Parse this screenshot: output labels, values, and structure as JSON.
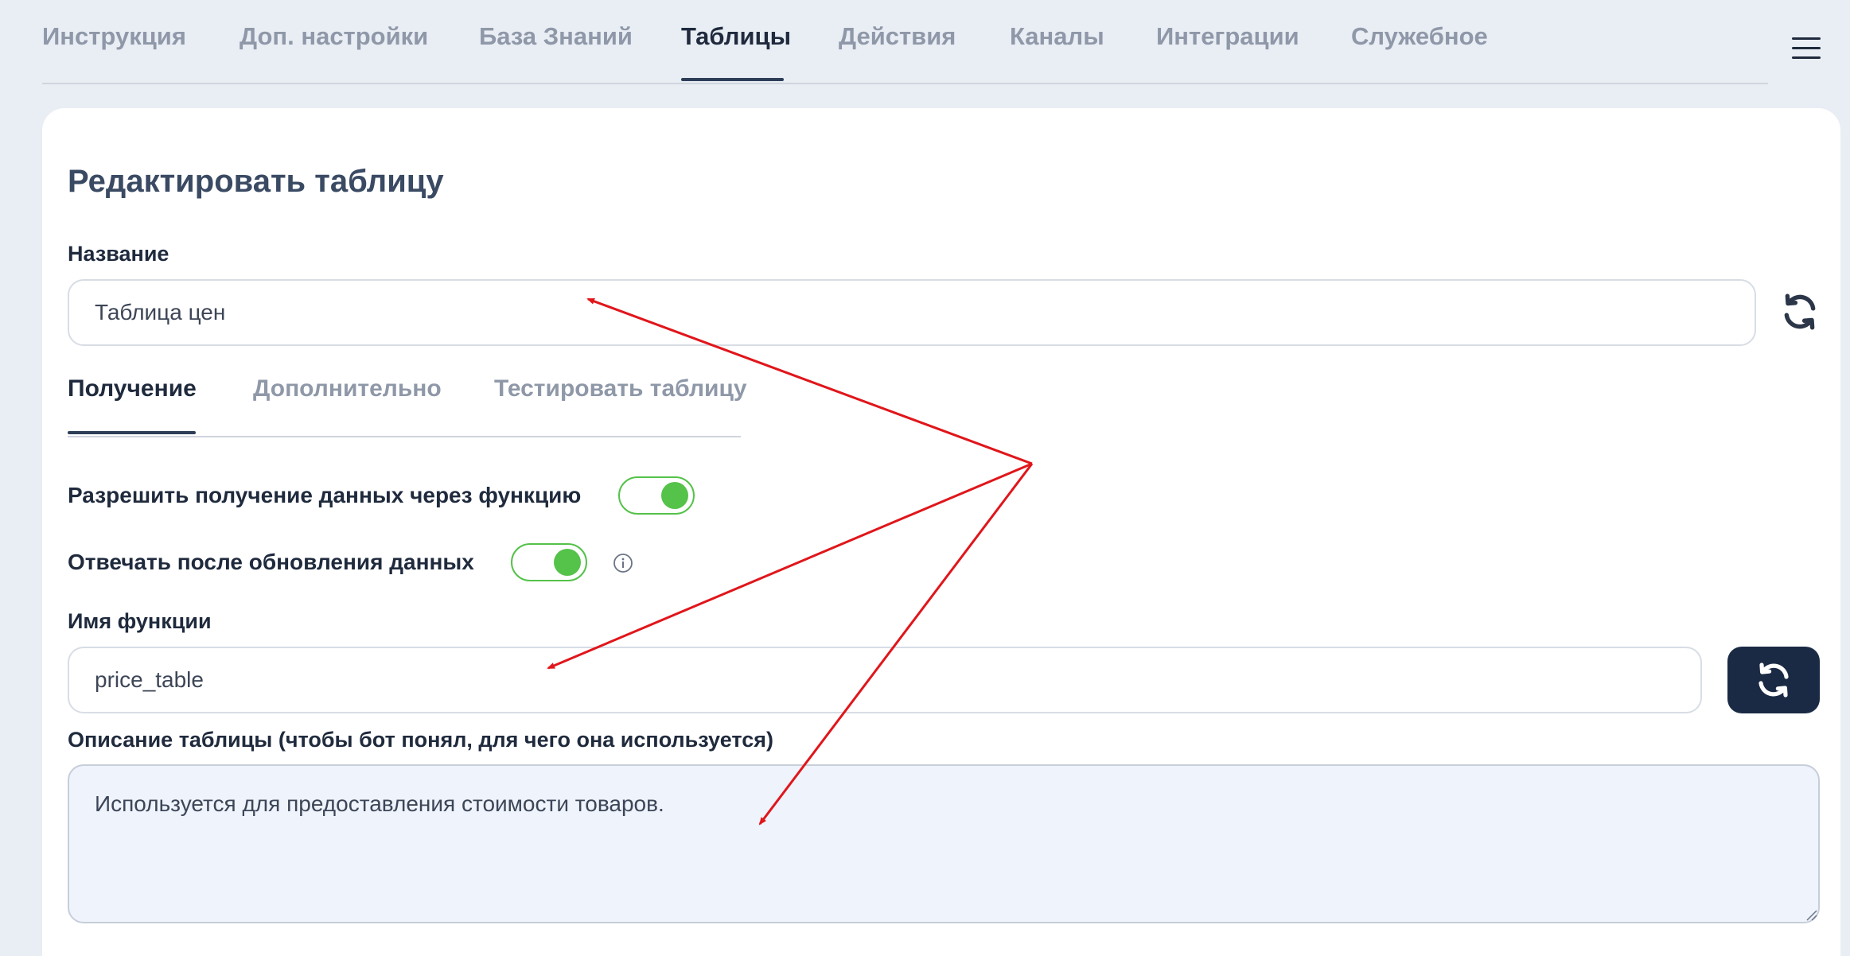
{
  "top_nav": {
    "tabs": [
      {
        "label": "Инструкция",
        "active": false
      },
      {
        "label": "Доп. настройки",
        "active": false
      },
      {
        "label": "База Знаний",
        "active": false
      },
      {
        "label": "Таблицы",
        "active": true
      },
      {
        "label": "Действия",
        "active": false
      },
      {
        "label": "Каналы",
        "active": false
      },
      {
        "label": "Интеграции",
        "active": false
      },
      {
        "label": "Служебное",
        "active": false
      }
    ],
    "menu_icon": "hamburger-menu-icon"
  },
  "form": {
    "title": "Редактировать таблицу",
    "name": {
      "label": "Название",
      "value": "Таблица цен",
      "refresh_icon": "refresh-icon"
    },
    "sub_tabs": [
      {
        "label": "Получение",
        "active": true
      },
      {
        "label": "Дополнительно",
        "active": false
      },
      {
        "label": "Тестировать таблицу",
        "active": false
      }
    ],
    "toggles": {
      "allow_function": {
        "label": "Разрешить получение данных через функцию",
        "on": true
      },
      "reply_after_update": {
        "label": "Отвечать после обновления данных",
        "on": true,
        "info_icon": "info-icon"
      }
    },
    "function_name": {
      "label": "Имя функции",
      "value": "price_table",
      "refresh_icon": "refresh-icon"
    },
    "description": {
      "label": "Описание таблицы (чтобы бот понял, для чего она используется)",
      "value": "Используется для предоставления стоимости товаров."
    }
  },
  "colors": {
    "page_bg": "#e9edf4",
    "card_bg": "#ffffff",
    "accent_dark": "#1b2a44",
    "toggle_on": "#55c24a",
    "annotation_arrows": "#e0161b"
  }
}
